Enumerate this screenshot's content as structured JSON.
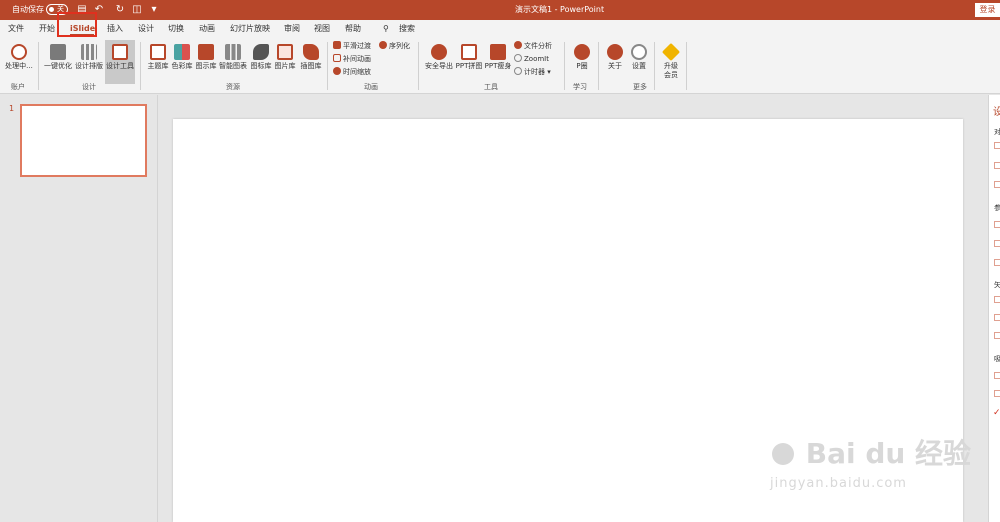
{
  "titlebar": {
    "autosave_label": "自动保存",
    "autosave_state": "关",
    "document_title": "演示文稿1 - PowerPoint",
    "login_label": "登录",
    "qa_icons": [
      "save-icon",
      "undo-icon",
      "redo-icon",
      "present-icon",
      "customize-icon"
    ]
  },
  "tabs": [
    {
      "label": "文件"
    },
    {
      "label": "开始"
    },
    {
      "label": "iSlide",
      "active": true
    },
    {
      "label": "插入"
    },
    {
      "label": "设计"
    },
    {
      "label": "切换"
    },
    {
      "label": "动画"
    },
    {
      "label": "幻灯片放映"
    },
    {
      "label": "审阅"
    },
    {
      "label": "视图"
    },
    {
      "label": "帮助"
    },
    {
      "label": "搜索"
    }
  ],
  "ribbon": {
    "account": {
      "group": "账户",
      "process_label": "处理中..."
    },
    "design": {
      "group": "设计",
      "one_click_label": "一键优化",
      "layout_label": "设计排版",
      "tools_label": "设计工具"
    },
    "resources": {
      "group": "资源",
      "items": [
        "主题库",
        "色彩库",
        "图示库",
        "智能图表",
        "图标库",
        "图片库",
        "插图库"
      ]
    },
    "animation": {
      "group": "动画",
      "smooth_label": "平滑过渡",
      "sequence_label": "序列化",
      "tween_label": "补间动画",
      "timeline_label": "时间缩放"
    },
    "tools": {
      "group": "工具",
      "export_label": "安全导出",
      "jigsaw_label": "PPT拼图",
      "slim_label": "PPT瘦身",
      "analysis_label": "文件分析",
      "zoomit_label": "ZoomIt",
      "timer_label": "计时器"
    },
    "learn": {
      "group": "学习",
      "p_label": "P圈"
    },
    "more": {
      "group": "更多",
      "about_label": "关于",
      "settings_label": "设置",
      "upgrade_label_1": "升级",
      "upgrade_label_2": "会员"
    }
  },
  "slides": {
    "number": "1"
  },
  "right_pane": {
    "title": "设",
    "labels": [
      "对",
      "参",
      "矢",
      "吸"
    ]
  },
  "watermark": {
    "brand": "Bai du 经验",
    "url": "jingyan.baidu.com"
  },
  "colors": {
    "accent": "#b7472a",
    "highlight_box": "#e0301e"
  }
}
